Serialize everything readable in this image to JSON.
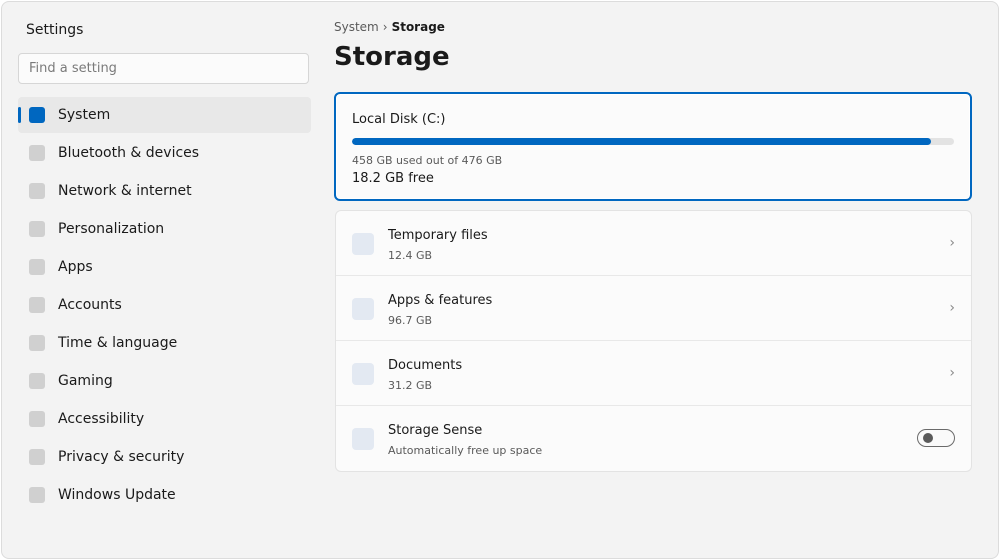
{
  "app": {
    "title": "Settings"
  },
  "search": {
    "placeholder": "Find a setting"
  },
  "sidebar": {
    "items": [
      {
        "label": "System",
        "selected": true
      },
      {
        "label": "Bluetooth & devices"
      },
      {
        "label": "Network & internet"
      },
      {
        "label": "Personalization"
      },
      {
        "label": "Apps"
      },
      {
        "label": "Accounts"
      },
      {
        "label": "Time & language"
      },
      {
        "label": "Gaming"
      },
      {
        "label": "Accessibility"
      },
      {
        "label": "Privacy & security"
      },
      {
        "label": "Windows Update"
      }
    ]
  },
  "breadcrumb": {
    "parent": "System",
    "separator": "›",
    "current": "Storage"
  },
  "page": {
    "title": "Storage"
  },
  "disk": {
    "name": "Local Disk (C:)",
    "used_text": "458 GB used out of 476 GB",
    "free_text": "18.2 GB free",
    "used_fraction": 0.962
  },
  "storage_items": [
    {
      "title": "Temporary files",
      "subtitle": "12.4 GB",
      "icon": "temp-files-icon",
      "action": "chevron",
      "chevron": "›"
    },
    {
      "title": "Apps & features",
      "subtitle": "96.7 GB",
      "icon": "apps-icon",
      "action": "chevron",
      "chevron": "›"
    },
    {
      "title": "Documents",
      "subtitle": "31.2 GB",
      "icon": "documents-icon",
      "action": "chevron",
      "chevron": "›"
    },
    {
      "title": "Storage Sense",
      "subtitle": "Automatically free up space",
      "icon": "storage-sense-icon",
      "action": "toggle",
      "toggle_on": false
    }
  ],
  "colors": {
    "accent": "#0067c0",
    "track": "#e3e3e3",
    "background": "#f3f3f3"
  }
}
